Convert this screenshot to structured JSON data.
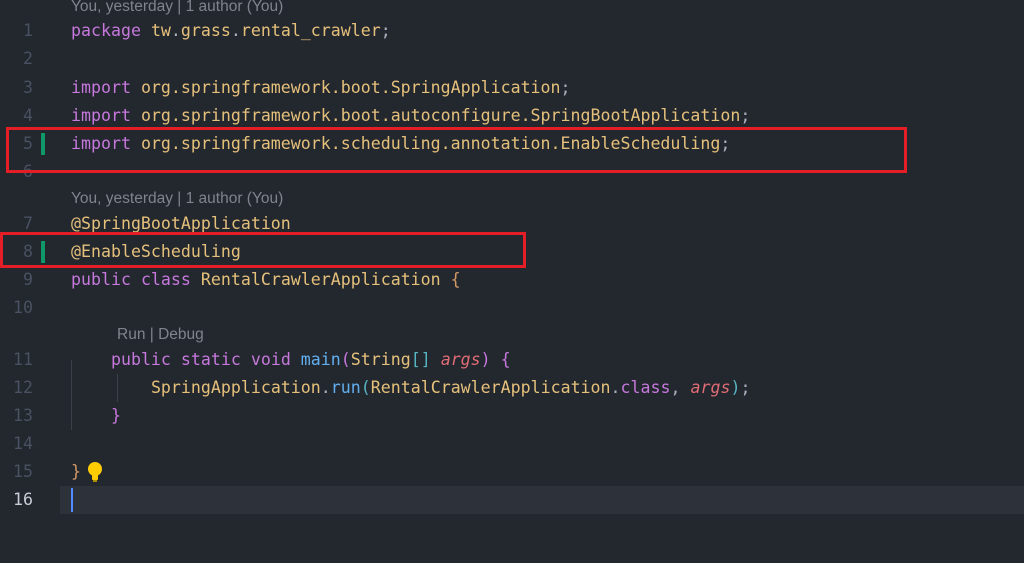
{
  "editor": {
    "colors": {
      "background": "#23272e",
      "keyword": "#c678dd",
      "type": "#e5c07b",
      "function": "#61afef",
      "parameter": "#e06c75",
      "added_gutter": "#109868",
      "highlight_box": "#e41e26"
    },
    "codelens": [
      {
        "before_line": 1,
        "text": "You, yesterday | 1 author (You)"
      },
      {
        "before_line": 7,
        "text": "You, yesterday | 1 author (You)"
      },
      {
        "before_line": 11,
        "text": "Run | Debug"
      }
    ],
    "lines": [
      {
        "n": "1",
        "tokens": [
          [
            "package ",
            "kw"
          ],
          [
            "tw",
            "ty"
          ],
          [
            ".",
            "pl"
          ],
          [
            "grass",
            "ty"
          ],
          [
            ".",
            "pl"
          ],
          [
            "rental_crawler",
            "ty"
          ],
          [
            ";",
            "pl"
          ]
        ]
      },
      {
        "n": "2",
        "tokens": []
      },
      {
        "n": "3",
        "tokens": [
          [
            "import ",
            "kw"
          ],
          [
            "org.springframework.boot.SpringApplication",
            "ty"
          ],
          [
            ";",
            "pl"
          ]
        ]
      },
      {
        "n": "4",
        "tokens": [
          [
            "import ",
            "kw"
          ],
          [
            "org.springframework.boot.autoconfigure.SpringBootApplication",
            "ty"
          ],
          [
            ";",
            "pl"
          ]
        ]
      },
      {
        "n": "5",
        "tokens": [
          [
            "import ",
            "kw"
          ],
          [
            "org.springframework.scheduling.annotation.EnableScheduling",
            "ty"
          ],
          [
            ";",
            "pl"
          ]
        ],
        "added": true
      },
      {
        "n": "6",
        "tokens": []
      },
      {
        "n": "7",
        "tokens": [
          [
            "@SpringBootApplication",
            "an"
          ]
        ]
      },
      {
        "n": "8",
        "tokens": [
          [
            "@EnableScheduling",
            "an"
          ]
        ],
        "added": true
      },
      {
        "n": "9",
        "tokens": [
          [
            "public ",
            "kw"
          ],
          [
            "class ",
            "kw"
          ],
          [
            "RentalCrawlerApplication ",
            "ty"
          ],
          [
            "{",
            "b1"
          ]
        ]
      },
      {
        "n": "10",
        "tokens": []
      },
      {
        "n": "11",
        "tokens": [
          [
            "    ",
            "pl"
          ],
          [
            "public ",
            "kw"
          ],
          [
            "static ",
            "kw"
          ],
          [
            "void ",
            "kw"
          ],
          [
            "main",
            "fn"
          ],
          [
            "(",
            "b2"
          ],
          [
            "String",
            "ty"
          ],
          [
            "[]",
            "b3"
          ],
          [
            " ",
            "pl"
          ],
          [
            "args",
            "pa"
          ],
          [
            ")",
            "b2"
          ],
          [
            " ",
            "pl"
          ],
          [
            "{",
            "b2"
          ]
        ]
      },
      {
        "n": "12",
        "tokens": [
          [
            "        ",
            "pl"
          ],
          [
            "SpringApplication",
            "ty"
          ],
          [
            ".",
            "pl"
          ],
          [
            "run",
            "fn"
          ],
          [
            "(",
            "b3"
          ],
          [
            "RentalCrawlerApplication",
            "ty"
          ],
          [
            ".",
            "pl"
          ],
          [
            "class",
            "kw"
          ],
          [
            ", ",
            "pl"
          ],
          [
            "args",
            "pa"
          ],
          [
            ")",
            "b3"
          ],
          [
            ";",
            "pl"
          ]
        ]
      },
      {
        "n": "13",
        "tokens": [
          [
            "    ",
            "pl"
          ],
          [
            "}",
            "b2"
          ]
        ]
      },
      {
        "n": "14",
        "tokens": []
      },
      {
        "n": "15",
        "tokens": [
          [
            "}",
            "b1"
          ]
        ],
        "bulb": "lightbulb-icon"
      },
      {
        "n": "16",
        "tokens": [],
        "current": true
      }
    ]
  }
}
